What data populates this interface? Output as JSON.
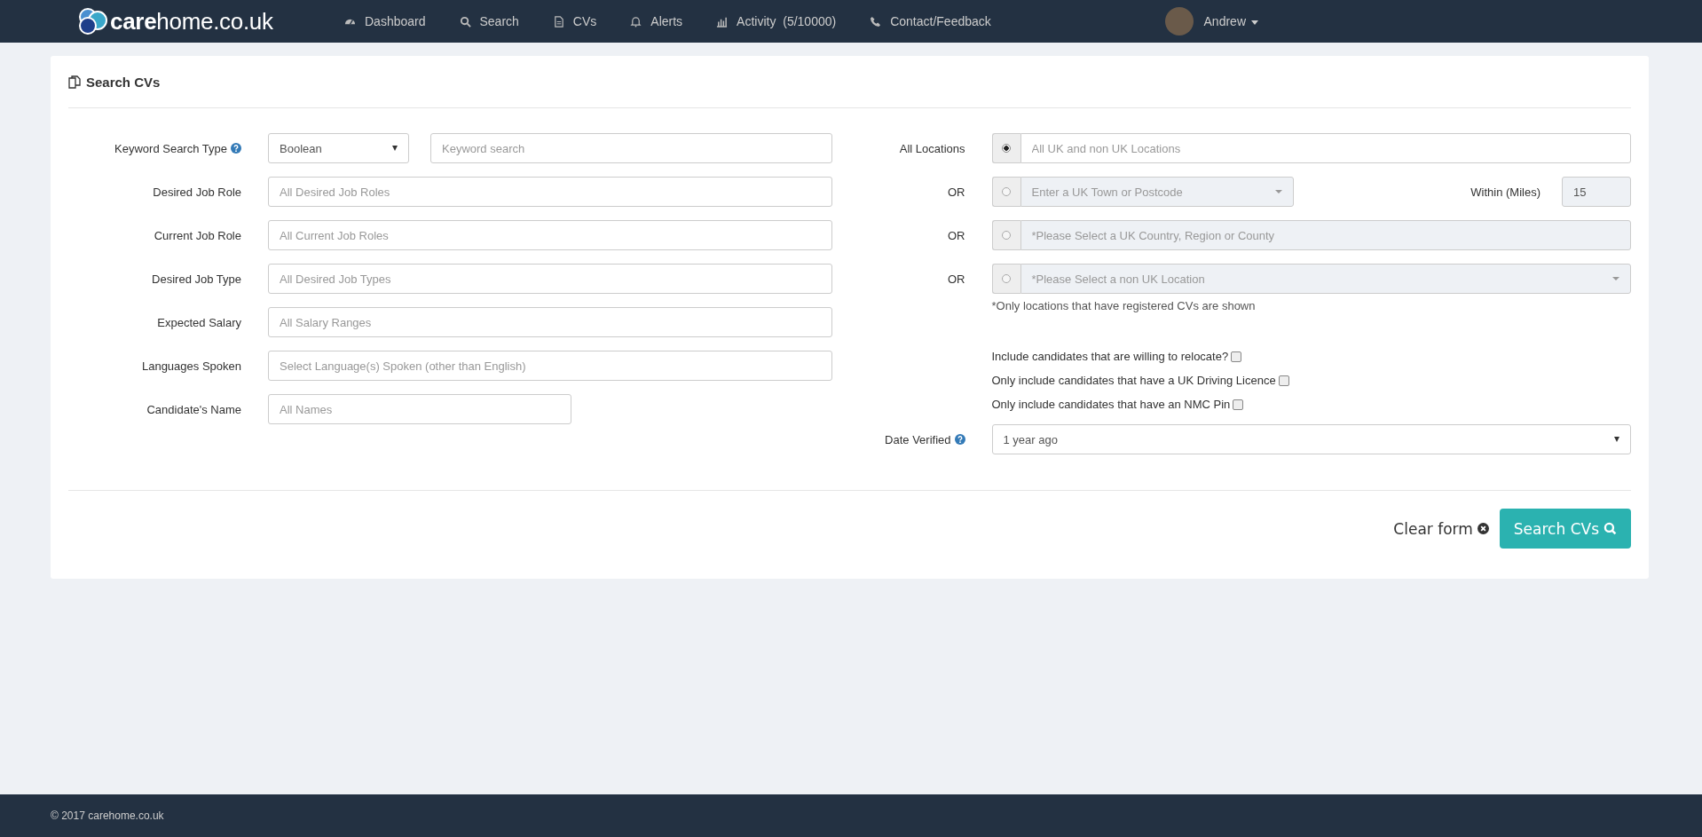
{
  "navbar": {
    "brand": "**care**home.co.uk",
    "items": [
      {
        "label": "Dashboard"
      },
      {
        "label": "Search"
      },
      {
        "label": "CVs"
      },
      {
        "label": "Alerts"
      },
      {
        "label": "Activity  (5/10000)"
      },
      {
        "label": "Contact/Feedback"
      }
    ],
    "user": {
      "name": "Andrew"
    }
  },
  "panel": {
    "title": "Search CVs"
  },
  "left_fields": [
    {
      "kind": "select-search",
      "label": "Keyword Search Type",
      "help": true,
      "value": "Boolean",
      "placeholder": "Keyword search"
    },
    {
      "kind": "text",
      "label": "Desired Job Role",
      "help": false,
      "placeholder": "All Desired Job Roles"
    },
    {
      "kind": "text",
      "label": "Current Job Role",
      "help": false,
      "placeholder": "All Current Job Roles"
    },
    {
      "kind": "text",
      "label": "Desired Job Type",
      "help": false,
      "placeholder": "All Desired Job Types"
    },
    {
      "kind": "text",
      "label": "Expected Salary",
      "help": false,
      "placeholder": "All Salary Ranges"
    },
    {
      "kind": "text",
      "label": "Languages Spoken",
      "help": false,
      "placeholder": "Select Language(s) Spoken (other than English)"
    },
    {
      "kind": "short",
      "label": "Candidate's Name",
      "help": false,
      "placeholder": "All Names"
    }
  ],
  "locations": [
    {
      "kind": "text",
      "label": "All Locations",
      "selected": true,
      "disabled": false,
      "placeholder": "All UK and non UK Locations"
    },
    {
      "kind": "dropdown-miles",
      "label": "OR",
      "selected": false,
      "disabled": true,
      "placeholder": "Enter a UK Town or Postcode",
      "miles_label": "Within (Miles)",
      "miles_value": "15"
    },
    {
      "kind": "text",
      "label": "OR",
      "selected": false,
      "disabled": true,
      "placeholder": "*Please Select a UK Country, Region or County"
    },
    {
      "kind": "dropdown",
      "label": "OR",
      "selected": false,
      "disabled": true,
      "placeholder": "*Please Select a non UK Location"
    }
  ],
  "locations_note": "*Only locations that have registered CVs are shown",
  "options": [
    {
      "label": "Include candidates that are willing to relocate?",
      "checked": false
    },
    {
      "label": "Only include candidates that have a UK Driving Licence",
      "checked": false
    },
    {
      "label": "Only include candidates that have an NMC Pin",
      "checked": false
    }
  ],
  "date_verified": {
    "label": "Date Verified",
    "help": true,
    "value": "1 year ago"
  },
  "actions": {
    "clear": "Clear form",
    "search": "Search CVs"
  },
  "footer": {
    "text": "© 2017 carehome.co.uk"
  }
}
